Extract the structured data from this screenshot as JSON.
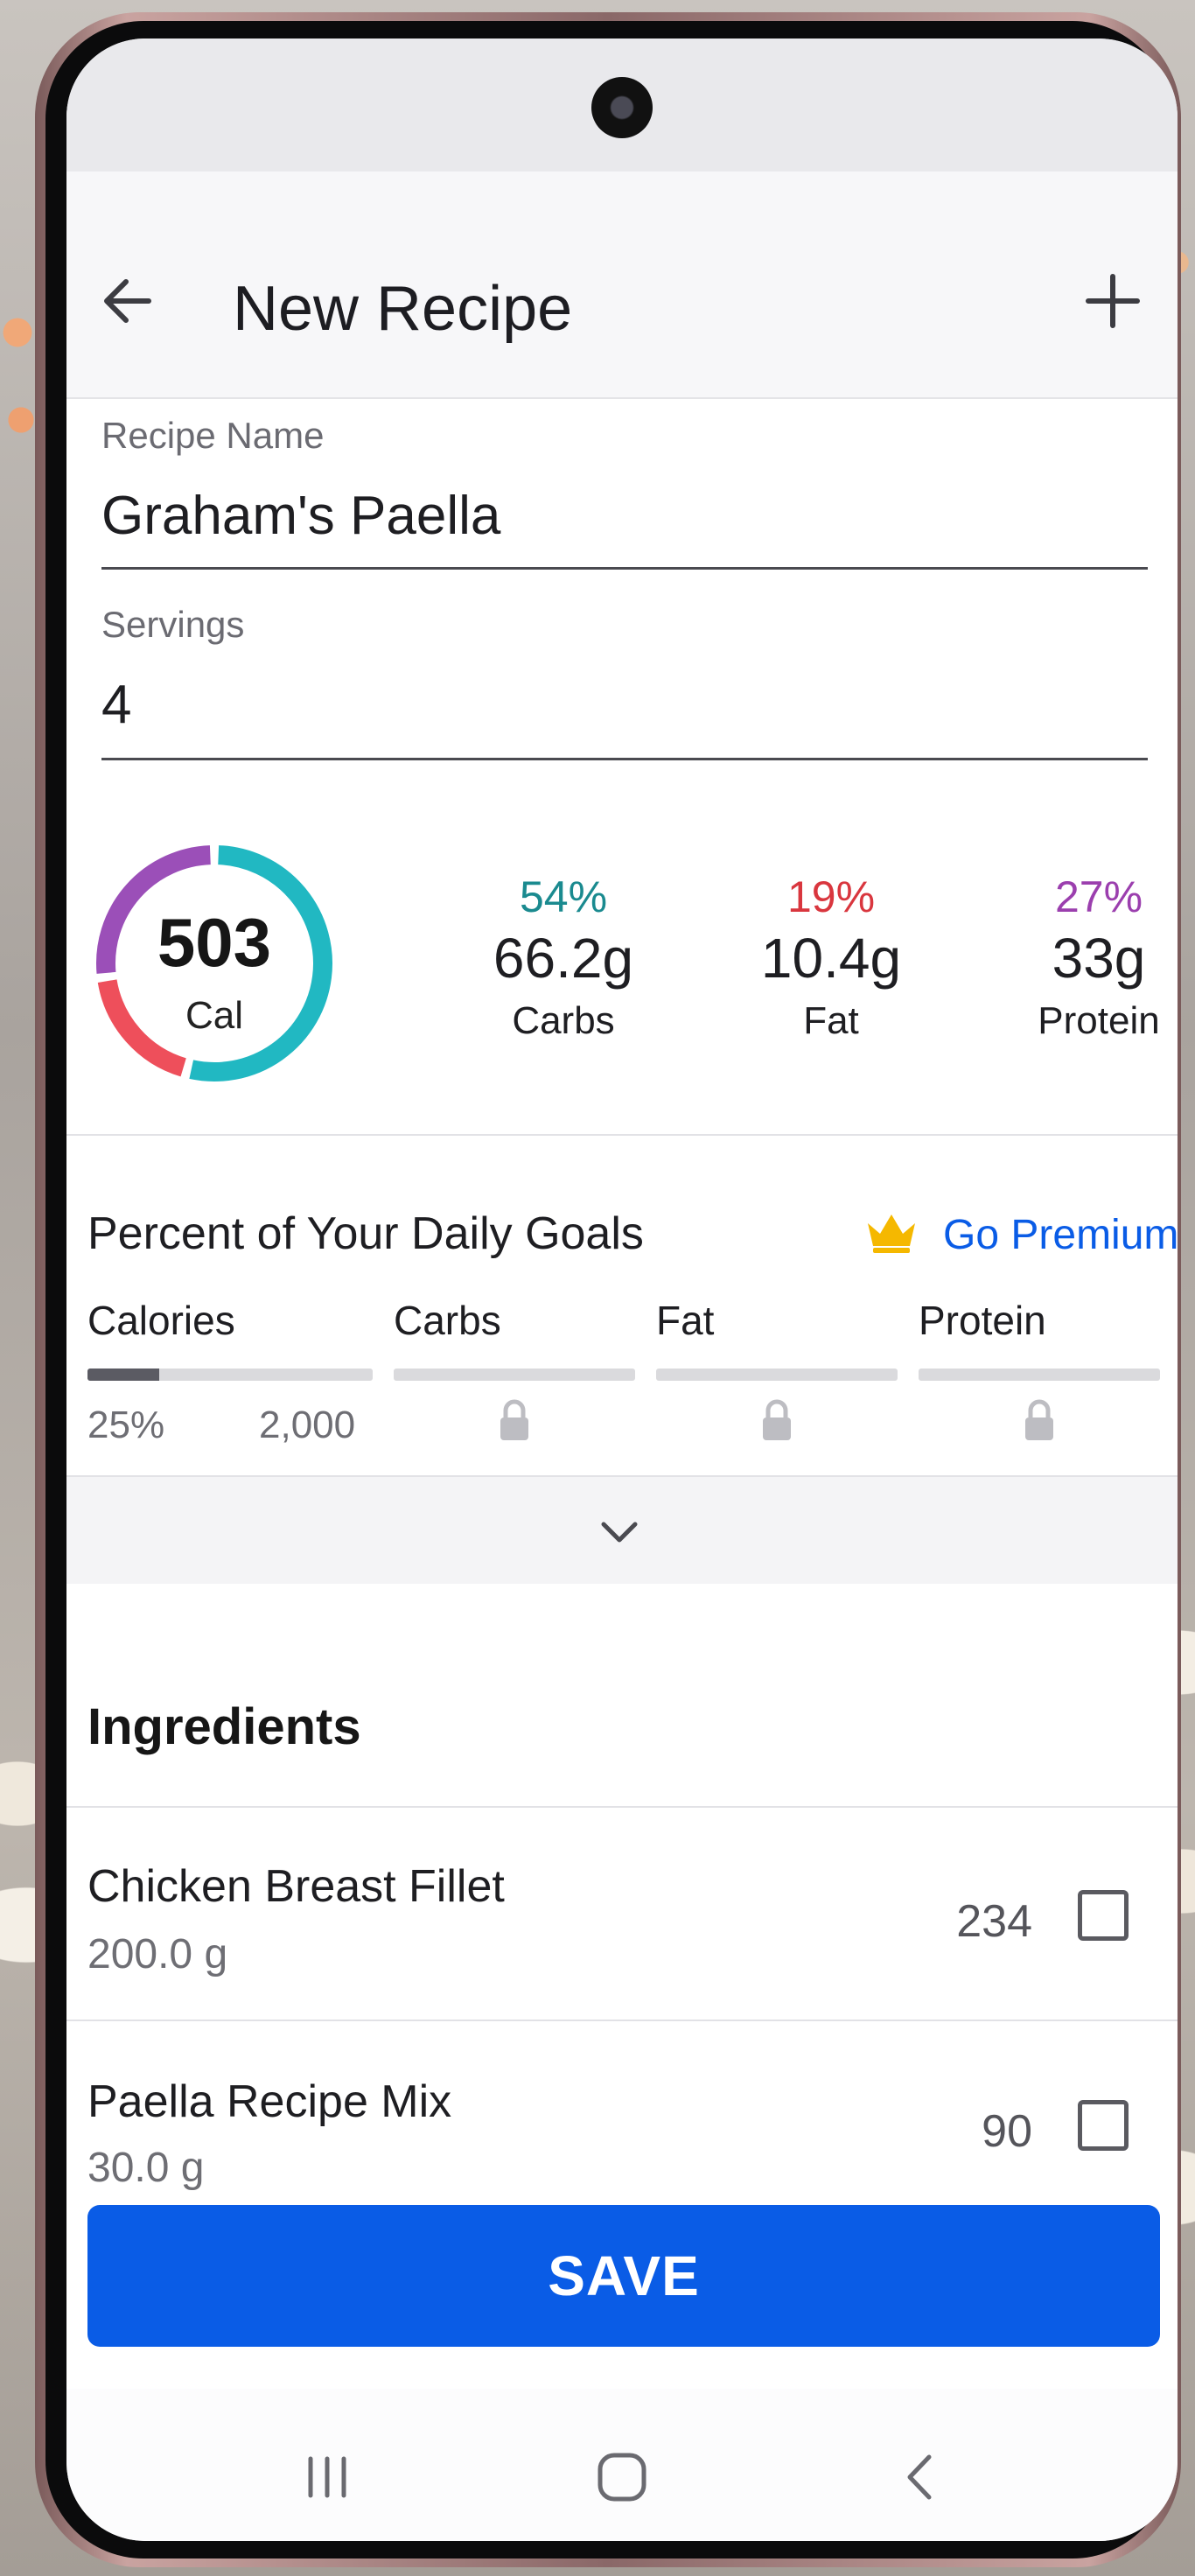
{
  "app": {
    "title": "New Recipe"
  },
  "icons": {
    "back": "arrow-left-icon",
    "add": "plus-icon",
    "crown": "crown-icon",
    "lock": "lock-icon",
    "expand": "chevron-down-icon",
    "checkbox": "checkbox-icon",
    "nav_recents": "recents-icon",
    "nav_home": "home-icon",
    "nav_back": "back-icon"
  },
  "form": {
    "recipe_name_label": "Recipe Name",
    "recipe_name_value": "Graham's Paella",
    "servings_label": "Servings",
    "servings_value": "4"
  },
  "summary": {
    "calories": "503",
    "calories_label": "Cal",
    "ring_fractions": {
      "carbs": 0.54,
      "fat": 0.19,
      "protein": 0.27
    },
    "macros": [
      {
        "pct": "54%",
        "amount": "66.2g",
        "name": "Carbs",
        "color": "#1a8a8f"
      },
      {
        "pct": "19%",
        "amount": "10.4g",
        "name": "Fat",
        "color": "#d9363e"
      },
      {
        "pct": "27%",
        "amount": "33g",
        "name": "Protein",
        "color": "#9b3fae"
      }
    ]
  },
  "goals": {
    "title": "Percent of Your Daily Goals",
    "premium_label": "Go Premium",
    "columns": [
      {
        "label": "Calories",
        "percent": "25%",
        "goal": "2,000",
        "fill_fraction": 0.25,
        "locked": false
      },
      {
        "label": "Carbs",
        "locked": true
      },
      {
        "label": "Fat",
        "locked": true
      },
      {
        "label": "Protein",
        "locked": true
      }
    ]
  },
  "ingredients": {
    "heading": "Ingredients",
    "items": [
      {
        "name": "Chicken Breast Fillet",
        "amount": "200.0 g",
        "calories": "234",
        "checked": false
      },
      {
        "name": "Paella Recipe Mix",
        "amount": "30.0 g",
        "calories": "90",
        "checked": false
      }
    ]
  },
  "actions": {
    "save_label": "SAVE"
  },
  "colors": {
    "accent": "#0a5ce6",
    "carbs": "#21b8c2",
    "fat": "#ee4f5b",
    "protein": "#9b4fb8",
    "crown": "#f5b800"
  }
}
